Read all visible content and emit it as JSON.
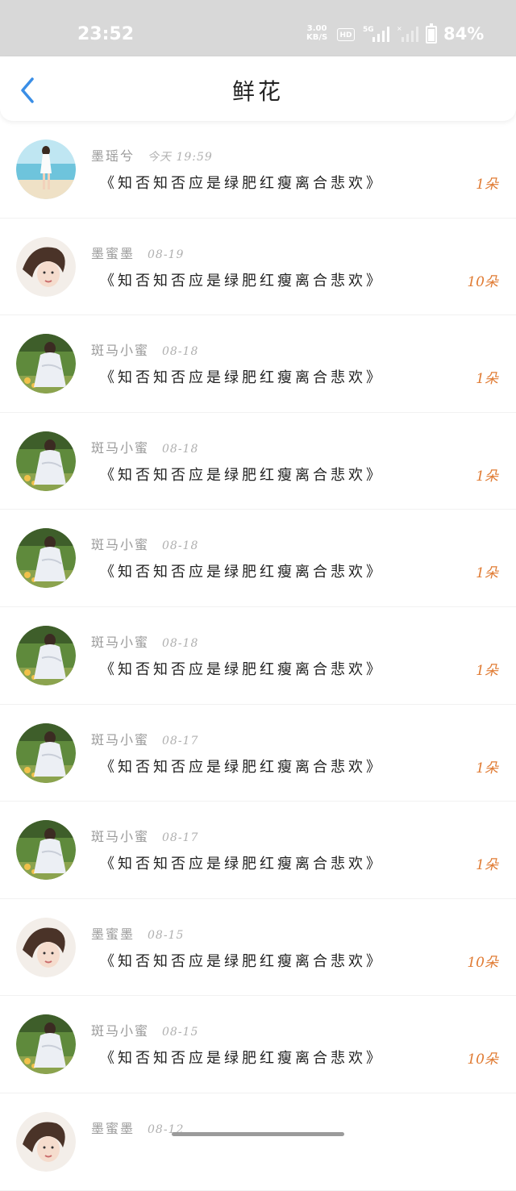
{
  "status_bar": {
    "time": "23:52",
    "net_speed_value": "3.00",
    "net_speed_unit": "KB/S",
    "hd_label": "HD",
    "network": "5G",
    "battery": "84%"
  },
  "header": {
    "title": "鲜花"
  },
  "list": [
    {
      "name": "墨瑶兮",
      "time": "今天 19:59",
      "message": "《知否知否应是绿肥红瘦离合悲欢》",
      "count": "1朵",
      "avatar": "beach"
    },
    {
      "name": "墨蜜墨",
      "time": "08-19",
      "message": "《知否知否应是绿肥红瘦离合悲欢》",
      "count": "10朵",
      "avatar": "portrait"
    },
    {
      "name": "斑马小蜜",
      "time": "08-18",
      "message": "《知否知否应是绿肥红瘦离合悲欢》",
      "count": "1朵",
      "avatar": "garden"
    },
    {
      "name": "斑马小蜜",
      "time": "08-18",
      "message": "《知否知否应是绿肥红瘦离合悲欢》",
      "count": "1朵",
      "avatar": "garden"
    },
    {
      "name": "斑马小蜜",
      "time": "08-18",
      "message": "《知否知否应是绿肥红瘦离合悲欢》",
      "count": "1朵",
      "avatar": "garden"
    },
    {
      "name": "斑马小蜜",
      "time": "08-18",
      "message": "《知否知否应是绿肥红瘦离合悲欢》",
      "count": "1朵",
      "avatar": "garden"
    },
    {
      "name": "斑马小蜜",
      "time": "08-17",
      "message": "《知否知否应是绿肥红瘦离合悲欢》",
      "count": "1朵",
      "avatar": "garden"
    },
    {
      "name": "斑马小蜜",
      "time": "08-17",
      "message": "《知否知否应是绿肥红瘦离合悲欢》",
      "count": "1朵",
      "avatar": "garden"
    },
    {
      "name": "墨蜜墨",
      "time": "08-15",
      "message": "《知否知否应是绿肥红瘦离合悲欢》",
      "count": "10朵",
      "avatar": "portrait"
    },
    {
      "name": "斑马小蜜",
      "time": "08-15",
      "message": "《知否知否应是绿肥红瘦离合悲欢》",
      "count": "10朵",
      "avatar": "garden"
    },
    {
      "name": "墨蜜墨",
      "time": "08-12",
      "message": "",
      "count": "",
      "avatar": "portrait"
    }
  ],
  "colors": {
    "accent": "#3a8ee6",
    "count": "#e07b33",
    "status_bar_bg": "#d8d8d8"
  }
}
